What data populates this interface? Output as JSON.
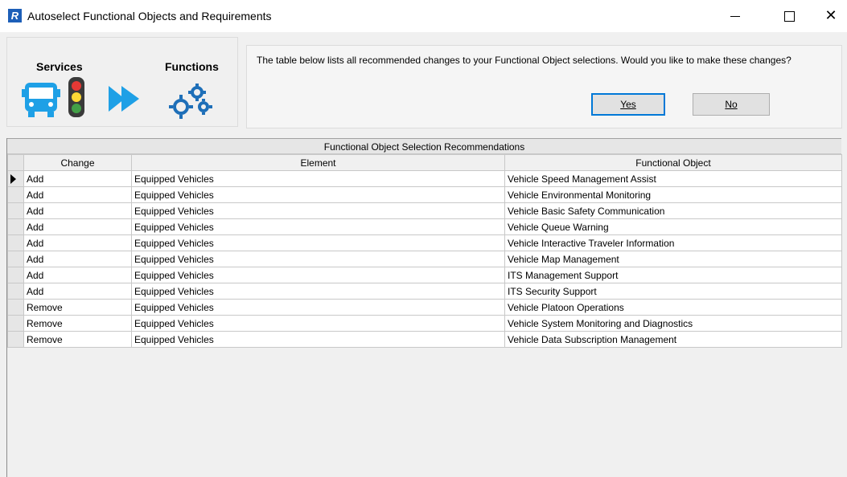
{
  "window": {
    "title": "Autoselect Functional Objects and Requirements",
    "app_icon_letter": "R"
  },
  "banner": {
    "services_label": "Services",
    "functions_label": "Functions",
    "icons": [
      "bus-icon",
      "traffic-light-icon",
      "double-arrow-icon",
      "gears-icon"
    ]
  },
  "prompt": {
    "message": "The table below lists all recommended changes to your Functional Object selections.  Would you like to make these changes?",
    "yes_label": "Yes",
    "no_label": "No"
  },
  "grid": {
    "caption": "Functional Object Selection Recommendations",
    "columns": [
      "Change",
      "Element",
      "Functional Object"
    ],
    "rows": [
      {
        "change": "Add",
        "element": "Equipped Vehicles",
        "functional_object": "Vehicle Speed Management Assist"
      },
      {
        "change": "Add",
        "element": "Equipped Vehicles",
        "functional_object": "Vehicle Environmental Monitoring"
      },
      {
        "change": "Add",
        "element": "Equipped Vehicles",
        "functional_object": "Vehicle Basic Safety Communication"
      },
      {
        "change": "Add",
        "element": "Equipped Vehicles",
        "functional_object": "Vehicle Queue Warning"
      },
      {
        "change": "Add",
        "element": "Equipped Vehicles",
        "functional_object": "Vehicle Interactive Traveler Information"
      },
      {
        "change": "Add",
        "element": "Equipped Vehicles",
        "functional_object": "Vehicle Map Management"
      },
      {
        "change": "Add",
        "element": "Equipped Vehicles",
        "functional_object": "ITS Management Support"
      },
      {
        "change": "Add",
        "element": "Equipped Vehicles",
        "functional_object": "ITS Security Support"
      },
      {
        "change": "Remove",
        "element": "Equipped Vehicles",
        "functional_object": "Vehicle Platoon Operations"
      },
      {
        "change": "Remove",
        "element": "Equipped Vehicles",
        "functional_object": "Vehicle System Monitoring and Diagnostics"
      },
      {
        "change": "Remove",
        "element": "Equipped Vehicles",
        "functional_object": "Vehicle Data Subscription Management"
      }
    ]
  }
}
